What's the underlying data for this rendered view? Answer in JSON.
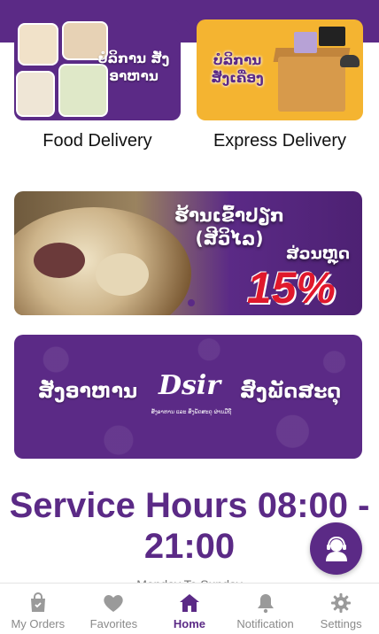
{
  "services": [
    {
      "lao_title": "ບໍລິການ ສັ່ງອາຫານ",
      "label": "Food Delivery"
    },
    {
      "lao_title": "ບໍລິການ ສັ່ງເຄື່ອງ",
      "label": "Express Delivery"
    }
  ],
  "promo_banner": {
    "title": "ຮ້ານເຂົ້າປຽກ (ສີວິໄລ)",
    "discount_label": "ສ່ວນຫຼຸດ",
    "discount_value": "15%"
  },
  "brand_banner": {
    "left_text": "ສັ່ງອາຫານ",
    "logo": "Dsir",
    "subtitle": "ສັ່ງອາຫານ ແລະ ສິ່ງພັດສະດຸ ຜ່ານມືຖື",
    "right_text": "ສົ່ງພັດສະດຸ"
  },
  "service_hours": {
    "text": "Service Hours 08:00 - 21:00",
    "days": "Monday To Sunday"
  },
  "colors": {
    "primary": "#5b2a86",
    "accent": "#f4b431",
    "discount": "#e0182c"
  },
  "support_button": {
    "icon": "support-agent-icon"
  },
  "nav": {
    "items": [
      {
        "label": "My Orders",
        "icon": "orders-bag-icon"
      },
      {
        "label": "Favorites",
        "icon": "heart-icon"
      },
      {
        "label": "Home",
        "icon": "home-icon",
        "active": true
      },
      {
        "label": "Notification",
        "icon": "bell-icon"
      },
      {
        "label": "Settings",
        "icon": "gear-icon"
      }
    ]
  }
}
